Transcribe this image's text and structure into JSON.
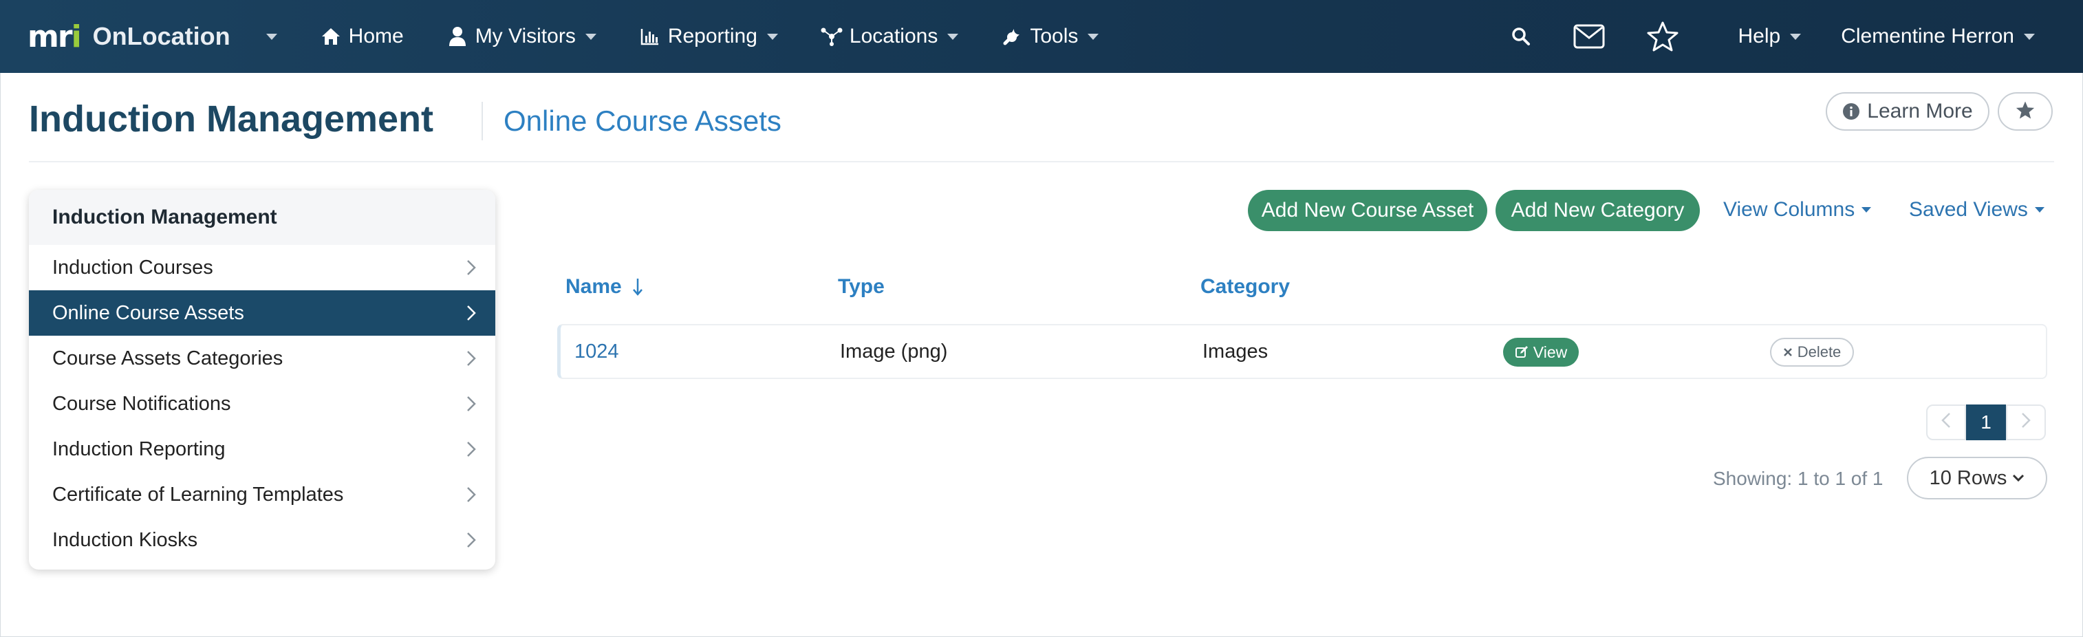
{
  "navbar": {
    "logo_text": "mri",
    "app_name": "OnLocation",
    "items": [
      {
        "label": "Home",
        "icon": "home-icon"
      },
      {
        "label": "My Visitors",
        "icon": "user-icon"
      },
      {
        "label": "Reporting",
        "icon": "bar-chart-icon"
      },
      {
        "label": "Locations",
        "icon": "network-icon"
      },
      {
        "label": "Tools",
        "icon": "wrench-icon"
      }
    ],
    "help_label": "Help",
    "user_name": "Clementine Herron"
  },
  "header": {
    "title": "Induction Management",
    "subtitle": "Online Course Assets",
    "learn_more_label": "Learn More"
  },
  "sidebar": {
    "heading": "Induction Management",
    "items": [
      {
        "label": "Induction Courses",
        "active": false
      },
      {
        "label": "Online Course Assets",
        "active": true
      },
      {
        "label": "Course Assets Categories",
        "active": false
      },
      {
        "label": "Course Notifications",
        "active": false
      },
      {
        "label": "Induction Reporting",
        "active": false
      },
      {
        "label": "Certificate of Learning Templates",
        "active": false
      },
      {
        "label": "Induction Kiosks",
        "active": false
      }
    ]
  },
  "toolbar": {
    "add_asset_label": "Add New Course Asset",
    "add_category_label": "Add New Category",
    "view_columns_label": "View Columns",
    "saved_views_label": "Saved Views"
  },
  "table": {
    "columns": [
      "Name",
      "Type",
      "Category"
    ],
    "sort": {
      "column": "Name",
      "direction": "descending"
    },
    "rows": [
      {
        "name": "1024",
        "type": "Image (png)",
        "category": "Images",
        "view_label": "View",
        "delete_label": "Delete"
      }
    ]
  },
  "pagination": {
    "current_page": "1",
    "showing_text": "Showing: 1 to 1 of 1",
    "rows_label": "10 Rows"
  },
  "colors": {
    "navbar": "#15344f",
    "accent_green": "#3a8f6a",
    "active_nav": "#1b4a69",
    "link_blue": "#2d80c2",
    "logo_green": "#9acb3c"
  }
}
